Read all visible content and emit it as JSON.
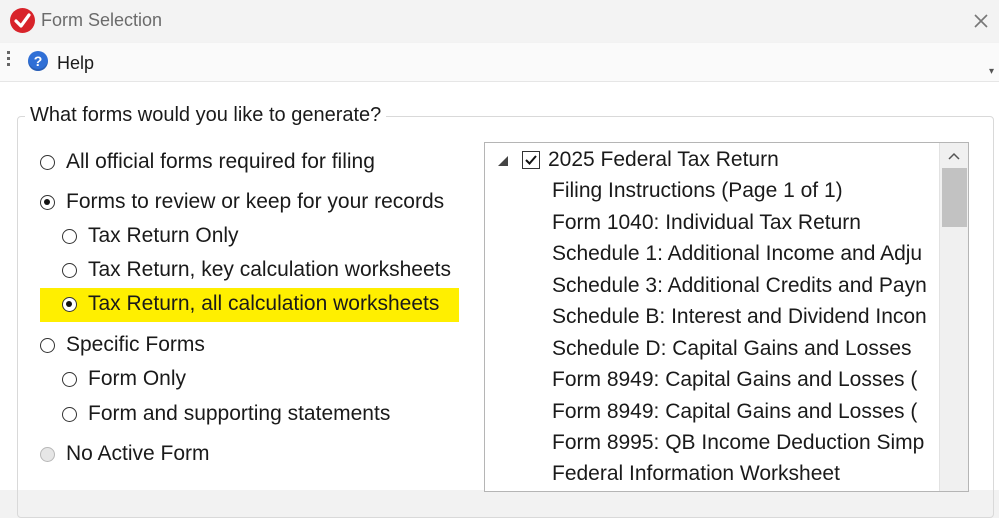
{
  "window": {
    "title": "Form Selection",
    "icon": "check-badge-icon",
    "close_icon": "close-icon"
  },
  "toolbar": {
    "help_label": "Help",
    "help_icon": "help-icon"
  },
  "group": {
    "title": "What forms would you like to generate?"
  },
  "options": {
    "all_official": "All official forms required for filing",
    "review": "Forms to review or keep for your records",
    "tax_return_only": "Tax Return Only",
    "tax_return_key": "Tax Return, key calculation worksheets",
    "tax_return_all": "Tax Return, all calculation worksheets",
    "specific": "Specific Forms",
    "form_only": "Form Only",
    "form_supporting": "Form and supporting statements",
    "no_active": "No Active Form"
  },
  "selected": {
    "main": "Forms to review or keep for your records",
    "sub": "Tax Return, all calculation worksheets"
  },
  "highlight_color": "#ffef00",
  "tree": {
    "root": "2025 Federal Tax Return",
    "root_checked": true,
    "items": [
      "Filing Instructions (Page 1 of 1)",
      "Form 1040: Individual Tax Return",
      "Schedule 1: Additional Income and Adju",
      "Schedule 3: Additional Credits and Payn",
      "Schedule B: Interest and Dividend Incon",
      "Schedule D: Capital Gains and Losses",
      "Form 8949: Capital Gains and Losses (",
      "Form 8949: Capital Gains and Losses (",
      "Form 8995: QB Income Deduction Simp",
      "Federal Information Worksheet"
    ]
  }
}
